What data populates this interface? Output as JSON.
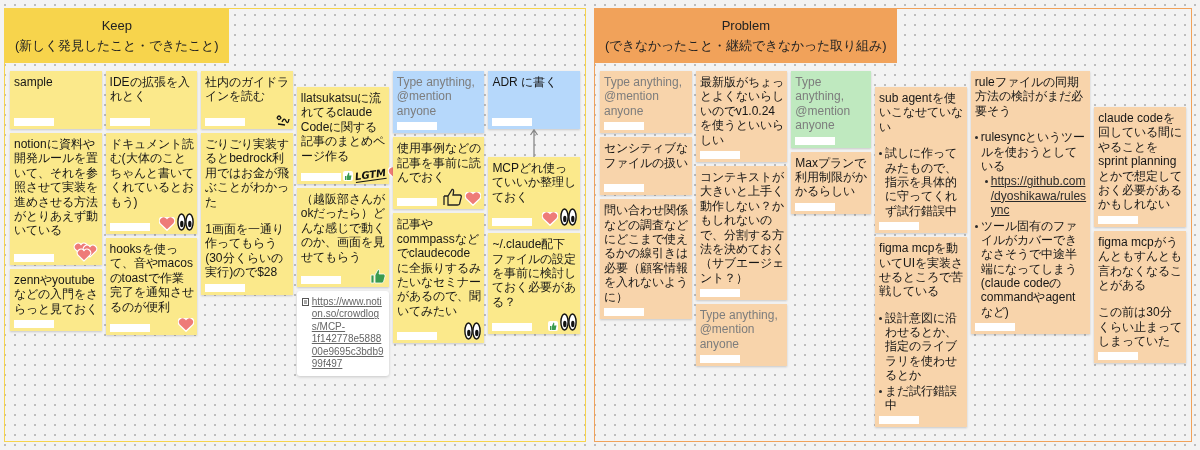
{
  "sections": [
    {
      "title": "Keep",
      "subtitle": "(新しく発見したこと・できたこと)",
      "color": "#f7d44c",
      "notes": [
        {
          "kind": "sticky",
          "color": "#fbe98b",
          "text": "sample"
        },
        {
          "kind": "sticky",
          "color": "#fbe98b",
          "text": "notionに資料や開発ルールを置いて、それを参照させて実装を進めさせる方法がとりあえず動いている",
          "stickers": [
            {
              "kind": "hearts"
            }
          ]
        },
        {
          "kind": "sticky",
          "color": "#fbe98b",
          "text": "zennやyoutubeなどの入門をさらっと見ておく"
        },
        {
          "kind": "sticky",
          "color": "#fbe98b",
          "text": "IDEの拡張を入れとく"
        },
        {
          "kind": "sticky",
          "color": "#fbe98b",
          "text": "ドキュメント読む(大体のことちゃんと書いてくれているとおもう)",
          "stickers": [
            {
              "kind": "heart"
            },
            {
              "kind": "eyes"
            }
          ]
        },
        {
          "kind": "sticky",
          "color": "#fbe98b",
          "text": "hooksを使って、音やmacosのtoastで作業完了を通知させるのが便利",
          "stickers": [
            {
              "kind": "heart"
            }
          ]
        },
        {
          "kind": "sticky",
          "color": "#fbe98b",
          "text": "社内のガイドラインを読む",
          "stickers": [
            {
              "kind": "doodle"
            }
          ]
        },
        {
          "kind": "sticky",
          "color": "#fbe98b",
          "paragraphs": [
            "ごりごり実装するとbedrock利用ではお金が飛ぶことがわかった",
            "1画面を一通り作ってもらう(30分くらいの実行)ので$28"
          ]
        },
        {
          "kind": "sticky",
          "color": "#fbe98b",
          "text": "llatsukatsuに流れてるclaude Codeに関する記事のまとめページ作る",
          "stickers": [
            {
              "kind": "mini-thumb"
            },
            {
              "kind": "lgtm",
              "text": "LGTM"
            },
            {
              "kind": "heart"
            }
          ]
        },
        {
          "kind": "sticky",
          "color": "#fbe98b",
          "text": "（越阪部さんがokだったら）どんな感じで動くのか、画面を見せてもらう",
          "stickers": [
            {
              "kind": "thumb"
            }
          ]
        },
        {
          "kind": "link",
          "url": "https://www.notion.so/crowdlogs/MCP-1f142778e588800e9695c3bdb999f497"
        },
        {
          "kind": "sticky",
          "color": "#b6d8fb",
          "placeholder": "Type anything, @mention anyone"
        },
        {
          "kind": "sticky",
          "color": "#fbe98b",
          "text": "使用事例などの記事を事前に読んでおく",
          "stickers": [
            {
              "kind": "thumb-outline"
            },
            {
              "kind": "heart"
            }
          ]
        },
        {
          "kind": "sticky",
          "color": "#fbe98b",
          "text": "記事やcommpassなどでclaudecodeに全振りするみたいなセミナーがあるので、聞いてみたい",
          "stickers": [
            {
              "kind": "eyes"
            }
          ]
        },
        {
          "kind": "sticky",
          "color": "#b6d8fb",
          "text": "ADR に書く"
        },
        {
          "kind": "sticky",
          "color": "#fbe98b",
          "text": "MCPどれ使っていいか整理しておく",
          "arrow_to_above": true,
          "stickers": [
            {
              "kind": "heart"
            },
            {
              "kind": "eyes"
            }
          ]
        },
        {
          "kind": "sticky",
          "color": "#fbe98b",
          "text": "~/.claude配下ファイルの設定を事前に検討しておく必要がある？",
          "stickers": [
            {
              "kind": "mini-thumb"
            },
            {
              "kind": "eyes"
            }
          ]
        }
      ]
    },
    {
      "title": "Problem",
      "subtitle": "(できなかったこと・継続できなかった取り組み)",
      "color": "#f1a25a",
      "notes": [
        {
          "kind": "sticky",
          "color": "#f8d4ab",
          "placeholder": "Type anything, @mention anyone"
        },
        {
          "kind": "sticky",
          "color": "#f8d4ab",
          "text": "センシティブなファイルの扱い"
        },
        {
          "kind": "sticky",
          "color": "#f8d4ab",
          "text": "問い合わせ関係などの調査などにどこまで使えるかの線引きは必要（顧客情報を入れないように）"
        },
        {
          "kind": "sticky",
          "color": "#f8d4ab",
          "text": "最新版がちょっとよくないらしいのでv1.0.24を使うといいらしい"
        },
        {
          "kind": "sticky",
          "color": "#f8d4ab",
          "text": "コンテキストが大きいと上手く動作しない？かもしれないので、分割する方法を決めておく（サブエージェント？）"
        },
        {
          "kind": "sticky",
          "color": "#f8d4ab",
          "placeholder": "Type anything, @mention anyone"
        },
        {
          "kind": "sticky",
          "color": "#bfe9bf",
          "placeholder": "Type anything, @mention anyone"
        },
        {
          "kind": "sticky",
          "color": "#f8d4ab",
          "text": "Maxプランで利用制限がかかるらしい"
        },
        {
          "kind": "sticky",
          "color": "#f8d4ab",
          "text": "sub agentを使いこなせていない",
          "bullets": [
            {
              "kind": "text",
              "text": "試しに作ってみたもので、指示を具体的に守ってくれず試行錯誤中"
            }
          ]
        },
        {
          "kind": "sticky",
          "color": "#f8d4ab",
          "text": "figma mcpを動いてUIを実装させるところで苦戦している",
          "bullets": [
            {
              "kind": "text",
              "text": "設計意図に沿わせるとか、指定のライブラリを使わせるとか"
            },
            {
              "kind": "text",
              "text": "まだ試行錯誤中"
            }
          ]
        },
        {
          "kind": "sticky",
          "color": "#f8d4ab",
          "text": "ruleファイルの同期方法の検討がまだ必要そう",
          "bullets": [
            {
              "kind": "text",
              "text": "rulesyncというツールを使おうとしている",
              "children": [
                {
                  "kind": "link",
                  "text": "https://github.com/dyoshikawa/rulesync"
                }
              ]
            },
            {
              "kind": "text",
              "text": "ツール固有のファイルがカバーできなさそうで中途半端になってしまう(claude codeのcommandやagentなど)"
            }
          ]
        },
        {
          "kind": "sticky",
          "color": "#f8d4ab",
          "text": "claude codeを回している間にやることをsprint planningとかで想定しておく必要があるかもしれない"
        },
        {
          "kind": "sticky",
          "color": "#f8d4ab",
          "paragraphs": [
            "figma mcpがうんともすんとも言わなくなることがある",
            "この前は30分くらい止まってしまっていた"
          ]
        }
      ]
    }
  ]
}
